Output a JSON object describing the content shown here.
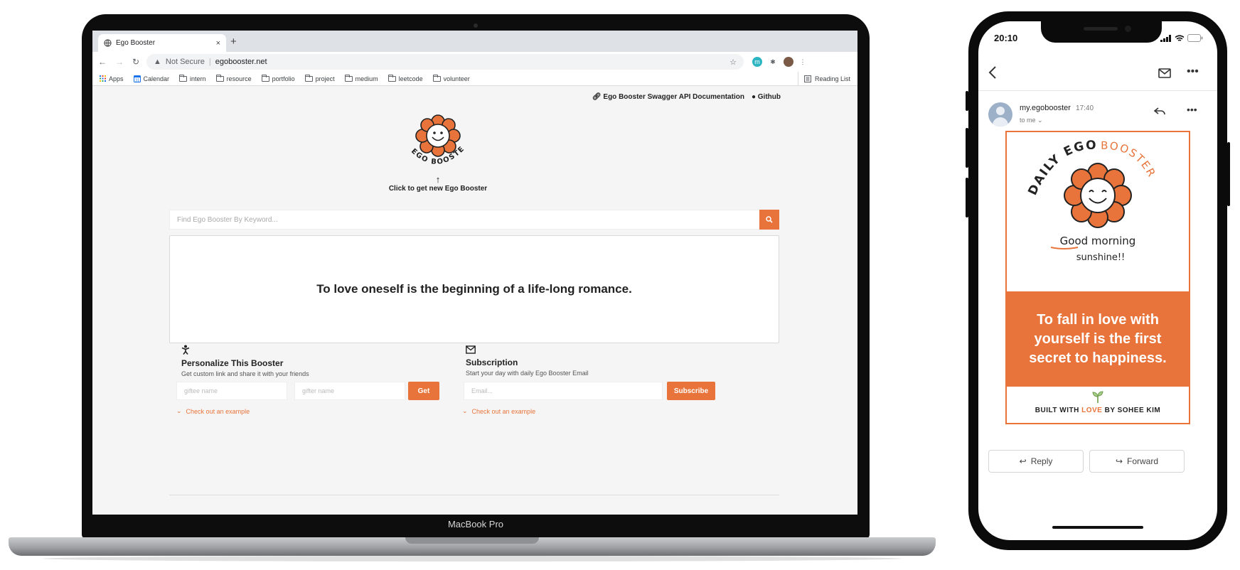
{
  "macbook": {
    "label": "MacBook Pro",
    "browser": {
      "tab_title": "Ego Booster",
      "tab_close": "×",
      "new_tab": "+",
      "security": "Not Secure",
      "separator": "|",
      "url": "egobooster.net",
      "bookmarks": [
        "Apps",
        "Calendar",
        "intern",
        "resource",
        "portfolio",
        "project",
        "medium",
        "leetcode",
        "volunteer"
      ],
      "reading_list": "Reading List"
    },
    "page": {
      "links": {
        "api_docs": "Ego Booster Swagger API Documentation",
        "github": "Github"
      },
      "logo": {
        "text": "EGO BOOSTER"
      },
      "click_label": "Click to get new Ego Booster",
      "search_placeholder": "Find Ego Booster By Keyword...",
      "quote": "To love oneself is the beginning of a life-long romance.",
      "personalize": {
        "title": "Personalize This Booster",
        "subtitle": "Get custom link and share it with your friends",
        "giftee_placeholder": "giftee name",
        "gifter_placeholder": "gifter name",
        "button": "Get",
        "example": "Check out an example"
      },
      "subscription": {
        "title": "Subscription",
        "subtitle": "Start your day with daily Ego Booster Email",
        "email_placeholder": "Email...",
        "button": "Subscribe",
        "example": "Check out an example"
      }
    }
  },
  "phone": {
    "time": "20:10",
    "sender": "my.egobooster",
    "sent_time": "17:40",
    "to": "to me",
    "card": {
      "art_text_left": "DAILY EGO",
      "art_text_right": "BOOSTER",
      "art_good": "Good morning",
      "art_sunshine": "sunshine!!",
      "quote": "To fall in love with yourself is the first secret to happiness.",
      "built_prefix": "BUILT WITH",
      "built_love": "LOVE",
      "built_suffix": "BY SOHEE KIM"
    },
    "reply": "Reply",
    "forward": "Forward"
  },
  "colors": {
    "accent": "#e8743b",
    "text": "#222222",
    "page_bg": "#f5f5f5"
  }
}
